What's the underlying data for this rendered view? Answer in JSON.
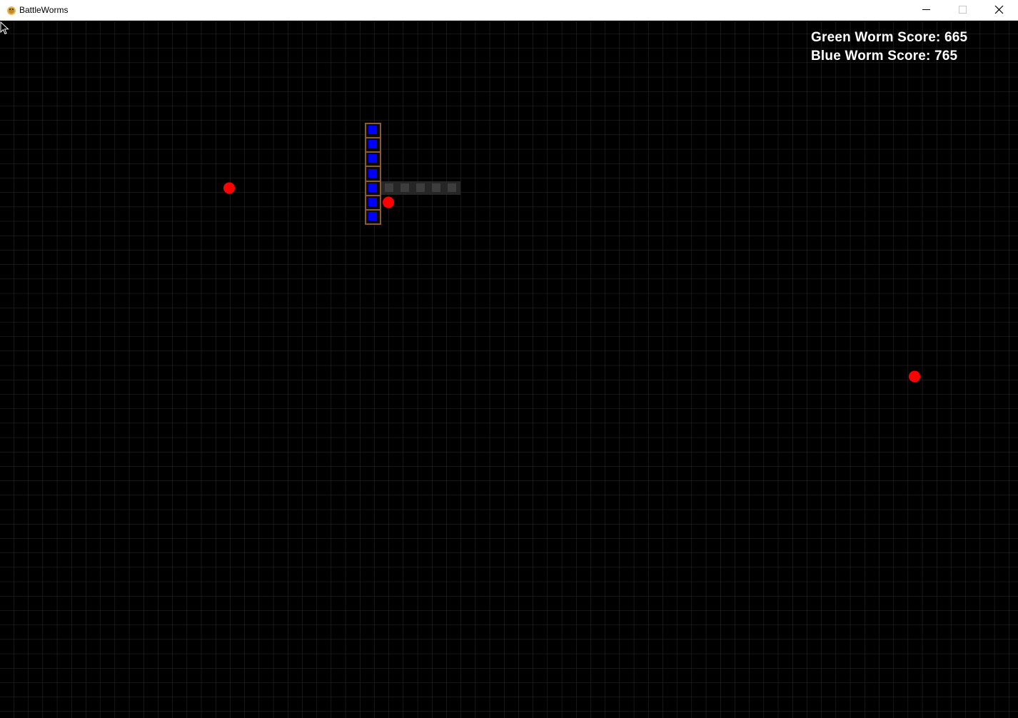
{
  "window": {
    "title": "BattleWorms",
    "icon": "pygame-snake-icon"
  },
  "hud": {
    "green_score_label": "Green Worm Score: 665",
    "blue_score_label": "Blue Worm Score: 765"
  },
  "board": {
    "grid_color": "#2b2b2b",
    "background": "#000000",
    "food_color": "#ff0000",
    "blue_worm_color": "#0000ff",
    "blue_worm_border": "#8b5a2b",
    "green_worm_color": "#3a3a3a"
  }
}
